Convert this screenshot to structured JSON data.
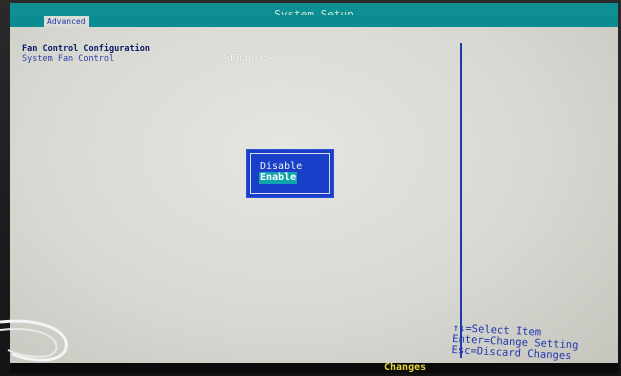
{
  "window": {
    "title": "System Setup"
  },
  "tabs": [
    {
      "label": "Advanced"
    }
  ],
  "section": {
    "title": "Fan Control Configuration",
    "setting_label": "System Fan Control",
    "setting_value": "<Enable>"
  },
  "popup": {
    "options": [
      "Disable",
      "Enable"
    ],
    "selected": "Enable"
  },
  "help": {
    "lines": [
      "↑↓=Select Item",
      "Enter=Change Setting",
      "Esc=Discard Changes"
    ]
  },
  "bottom_bar": {
    "label": "Changes"
  },
  "colors": {
    "title_bar": "#0d8f93",
    "background": "#dcdcd6",
    "popup": "#1a3fc9",
    "highlight": "#0fa7ad",
    "help_text": "#2036b0"
  }
}
